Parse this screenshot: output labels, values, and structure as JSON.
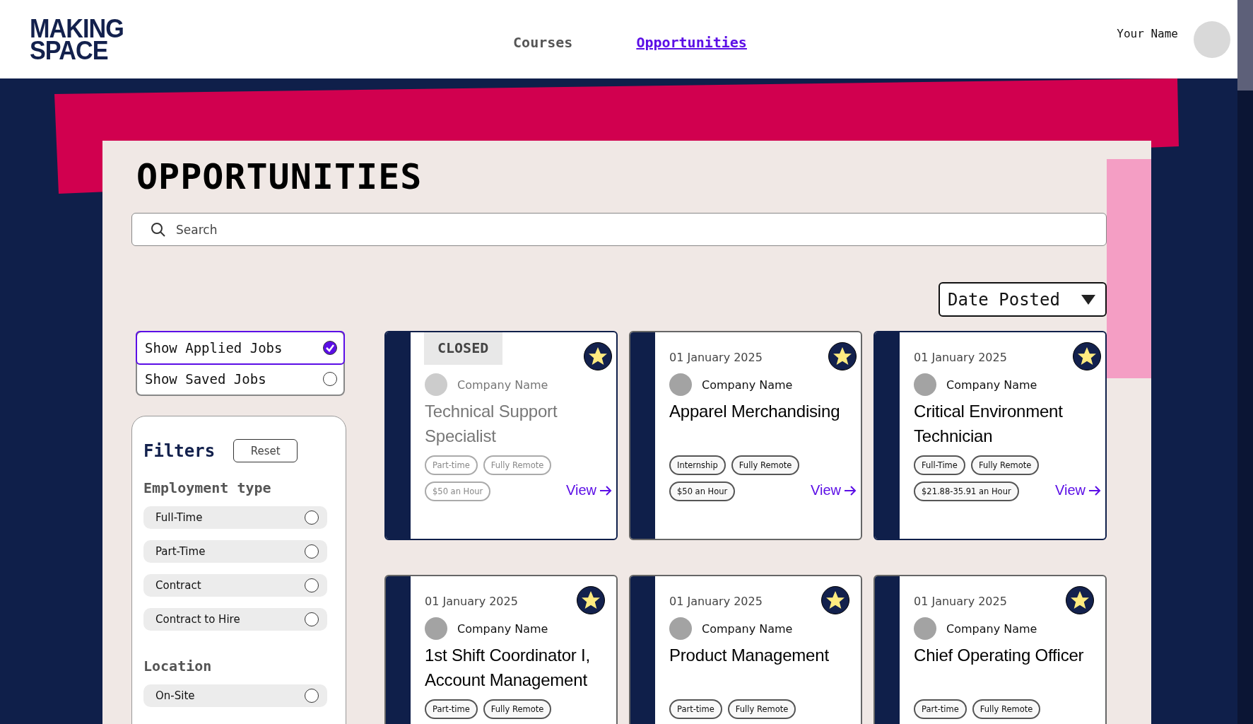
{
  "header": {
    "logo": [
      "MAKING",
      "SPACE"
    ],
    "nav": [
      {
        "label": "Courses",
        "selected": false
      },
      {
        "label": "Opportunities",
        "selected": true
      }
    ],
    "user": {
      "name": "Your Name"
    }
  },
  "page": {
    "title": "OPPORTUNITIES",
    "search": {
      "placeholder": "Search"
    },
    "sort": {
      "value": "Date Posted"
    }
  },
  "toggles": [
    {
      "label": "Show Applied Jobs",
      "selected": true
    },
    {
      "label": "Show Saved Jobs",
      "selected": false
    }
  ],
  "filters": {
    "title": "Filters",
    "reset": "Reset",
    "groups": [
      {
        "title": "Employment type",
        "options": [
          {
            "label": "Full-Time",
            "checked": false
          },
          {
            "label": "Part-Time",
            "checked": false
          },
          {
            "label": "Contract",
            "checked": false
          },
          {
            "label": "Contract to Hire",
            "checked": false
          }
        ]
      },
      {
        "title": "Location",
        "options": [
          {
            "label": "On-Site",
            "checked": false
          }
        ]
      }
    ]
  },
  "jobs": [
    {
      "closed": true,
      "badge": "CLOSED",
      "focused": true,
      "saved": true,
      "company": "Company Name",
      "title": "Technical Support Specialist",
      "tags": [
        "Part-time",
        "Fully Remote",
        "$50 an Hour"
      ],
      "link": "View"
    },
    {
      "closed": false,
      "date": "01 January 2025",
      "focused": false,
      "saved": true,
      "company": "Company Name",
      "title": "Apparel Merchandising",
      "tags": [
        "Internship",
        "Fully Remote",
        "$50 an Hour"
      ],
      "link": "View"
    },
    {
      "closed": false,
      "date": "01 January 2025",
      "focused": true,
      "saved": true,
      "company": "Company Name",
      "title": "Critical Environment Technician",
      "tags": [
        "Full-Time",
        "Fully Remote",
        "$21.88-35.91 an Hour"
      ],
      "link": "View"
    },
    {
      "closed": false,
      "date": "01 January 2025",
      "focused": false,
      "saved": true,
      "company": "Company Name",
      "title": "1st Shift Coordinator I, Account Management",
      "tags": [
        "Part-time",
        "Fully Remote"
      ]
    },
    {
      "closed": false,
      "date": "01 January 2025",
      "focused": false,
      "saved": true,
      "company": "Company Name",
      "title": "Product Management",
      "tags": [
        "Part-time",
        "Fully Remote"
      ]
    },
    {
      "closed": false,
      "date": "01 January 2025",
      "focused": false,
      "saved": true,
      "company": "Company Name",
      "title": "Chief Operating Officer",
      "tags": [
        "Part-time",
        "Fully Remote"
      ]
    }
  ]
}
